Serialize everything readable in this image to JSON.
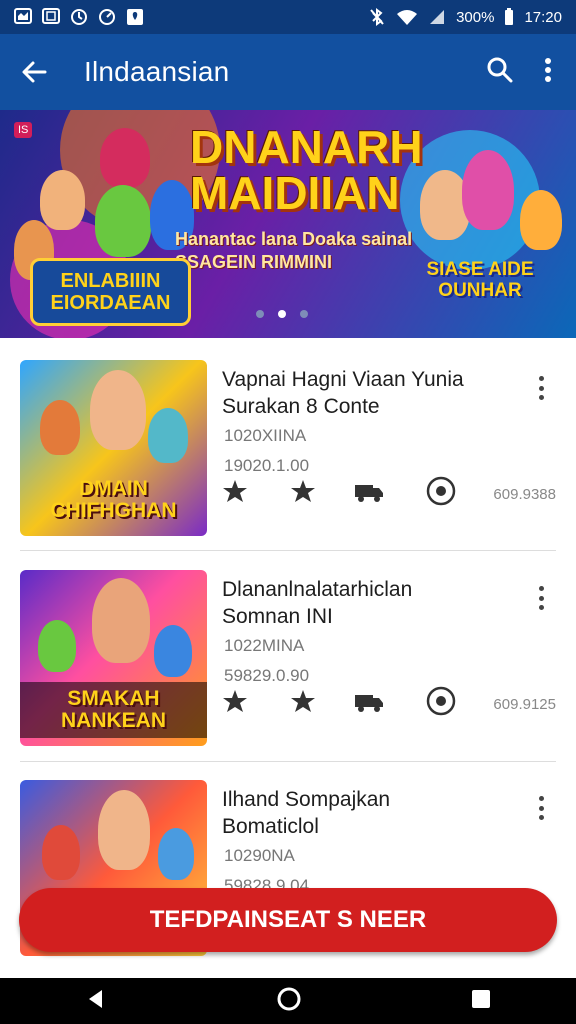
{
  "status_bar": {
    "battery": "300%",
    "time": "17:20"
  },
  "app_bar": {
    "title": "Ilndaansian"
  },
  "banner": {
    "headline_line1": "DNANARH",
    "headline_line2": "MAIDIIAN",
    "subtitle_line1": "Hanantac lana Doaka sainal",
    "subtitle_line2": "SSAGEIN RIMMINI",
    "left_badge_line1": "ENLABIIIN",
    "left_badge_line2": "EIORDAEAN",
    "right_badge_line1": "SIASE AIDE",
    "right_badge_line2": "OUNHAR",
    "corner_tag": "IS",
    "carousel_active_index": 1
  },
  "list": {
    "items": [
      {
        "title": "Vapnai Hagni Viaan Yunia Surakan 8 Conte",
        "meta1": "1020XIINA",
        "meta2": "19020.1.00",
        "thumb_label": "DMAIN CHIFHGHAN",
        "count": "609.9388"
      },
      {
        "title": "Dlananlnalatarhiclan Somnan INI",
        "meta1": "1022MINA",
        "meta2": "59829.0.90",
        "thumb_label": "SMAKAH NANKEAN",
        "count": "609.9125"
      },
      {
        "title": "Ilhand Sompajkan Bomaticlol",
        "meta1": "10290NA",
        "meta2": "59828.9.04",
        "thumb_label": "",
        "count": ""
      }
    ]
  },
  "cta": {
    "label": "TEFDPAINSEAT S NEER"
  },
  "colors": {
    "status_bar": "#0d3a7a",
    "app_bar": "#1250a0",
    "cta": "#d21f1f",
    "navbar": "#000000"
  },
  "icons": {
    "back": "arrow-left-icon",
    "search": "search-icon",
    "more": "more-vert-icon",
    "star": "star-icon",
    "truck": "truck-icon",
    "camera": "camera-icon",
    "nav_back": "triangle-back-icon",
    "nav_home": "circle-home-icon",
    "nav_recent": "square-recent-icon"
  }
}
